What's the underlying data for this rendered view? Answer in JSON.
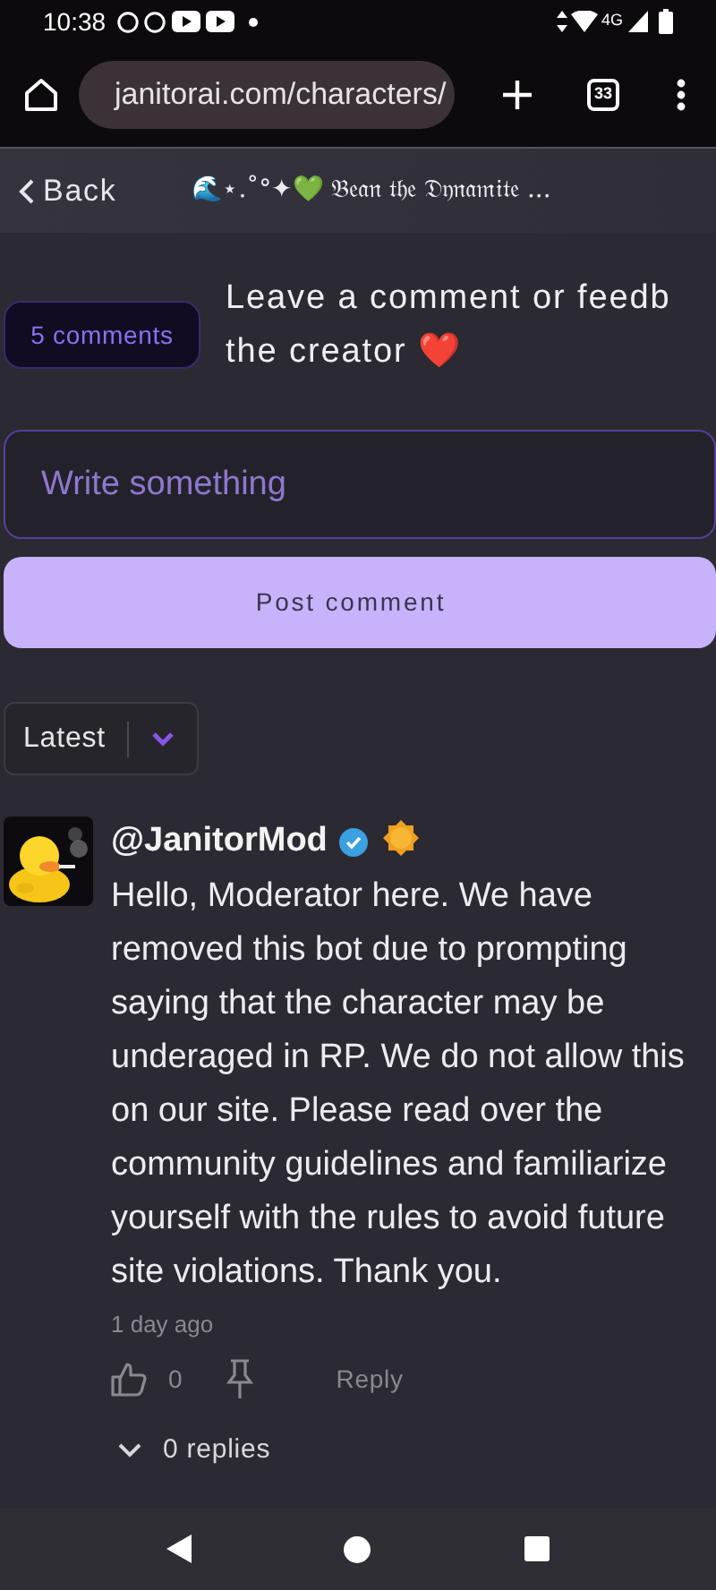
{
  "status_bar": {
    "time": "10:38",
    "network": "4G"
  },
  "browser": {
    "url": "janitorai.com/characters/",
    "tab_count": "33"
  },
  "header": {
    "back": "Back",
    "title": "🌊⋆.˚°✦💚 𝔅𝔢𝔞𝔫 𝔱𝔥𝔢 𝔇𝔶𝔫𝔞𝔪𝔦𝔱𝔢 ..."
  },
  "comments_section": {
    "count_badge": "5 comments",
    "prompt_lines": [
      "Leave a comment or feedb",
      "the creator ❤️"
    ],
    "input": {
      "placeholder": "Write something"
    },
    "post_button": "Post comment",
    "sort": "Latest"
  },
  "comments": [
    {
      "author": "@JanitorMod",
      "verified": true,
      "badge": true,
      "text": "Hello, Moderator here. We have removed this bot due to prompting saying that the character may be underaged in RP. We do not allow this on our site. Please read over the community guidelines and familiarize yourself with the rules to avoid future site violations. Thank you.",
      "time": "1 day ago",
      "likes": "0",
      "reply": "Reply",
      "replies": "0 replies"
    }
  ]
}
